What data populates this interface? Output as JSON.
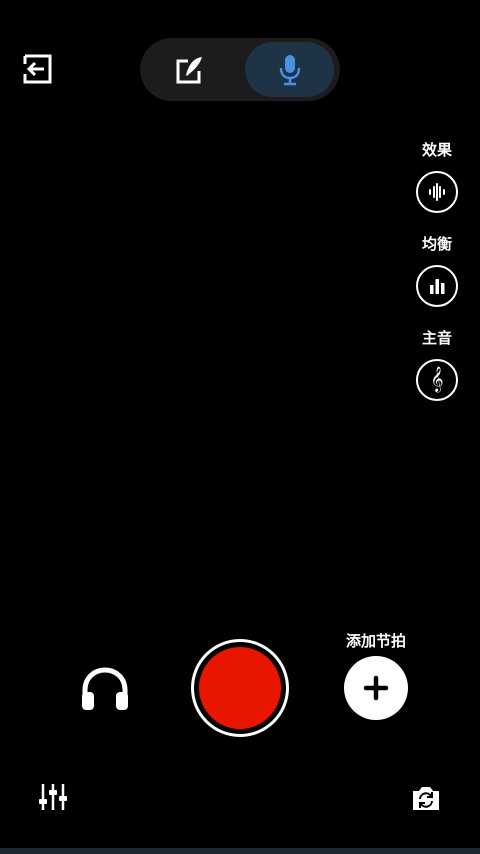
{
  "top_bar": {
    "exit_icon": "exit-icon",
    "mode_toggle": {
      "options": [
        {
          "icon": "edit-feather-icon",
          "selected": false
        },
        {
          "icon": "microphone-icon",
          "selected": true
        }
      ],
      "active_color": "#4a90e2"
    }
  },
  "side_tools": [
    {
      "label": "效果",
      "icon": "waveform-icon"
    },
    {
      "label": "均衡",
      "icon": "equalizer-bars-icon"
    },
    {
      "label": "主音",
      "icon": "treble-clef-icon"
    }
  ],
  "bottom_controls": {
    "headphones_icon": "headphones-icon",
    "record_color": "#e81600",
    "add_beat_label": "添加节拍",
    "add_beat_icon": "plus-icon",
    "mixer_icon": "mixer-sliders-icon",
    "flip_camera_icon": "camera-flip-icon"
  }
}
